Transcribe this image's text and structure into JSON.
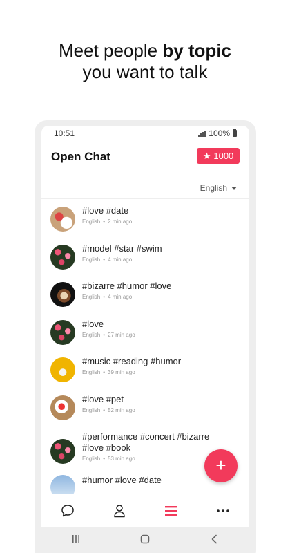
{
  "headline": {
    "line1_prefix": "Meet people ",
    "line1_bold": "by topic",
    "line2": "you want to talk"
  },
  "status_bar": {
    "time": "10:51",
    "battery": "100%"
  },
  "app_bar": {
    "title": "Open Chat",
    "points": "1000",
    "points_icon": "star-icon"
  },
  "language_filter": {
    "selected": "English"
  },
  "chats": [
    {
      "tags": "#love  #date",
      "language": "English",
      "time": "2 min ago",
      "avatar": "dessert"
    },
    {
      "tags": "#model  #star  #swim",
      "language": "English",
      "time": "4 min ago",
      "avatar": "flowers"
    },
    {
      "tags": "#bizarre  #humor  #love",
      "language": "English",
      "time": "4 min ago",
      "avatar": "coffee"
    },
    {
      "tags": "#love",
      "language": "English",
      "time": "27 min ago",
      "avatar": "flowers"
    },
    {
      "tags": "#music  #reading  #humor",
      "language": "English",
      "time": "39 min ago",
      "avatar": "drink"
    },
    {
      "tags": "#love  #pet",
      "language": "English",
      "time": "52 min ago",
      "avatar": "heart"
    },
    {
      "tags": "#performance  #concert  #bizarre  #love  #book",
      "language": "English",
      "time": "53 min ago",
      "avatar": "flowers"
    },
    {
      "tags": "#humor  #love  #date",
      "language": "",
      "time": "",
      "avatar": "sky"
    }
  ],
  "fab": {
    "label": "+"
  },
  "bottom_nav": [
    "chat-bubble-icon",
    "person-icon",
    "list-icon",
    "more-icon"
  ],
  "colors": {
    "accent": "#f23a5b"
  }
}
